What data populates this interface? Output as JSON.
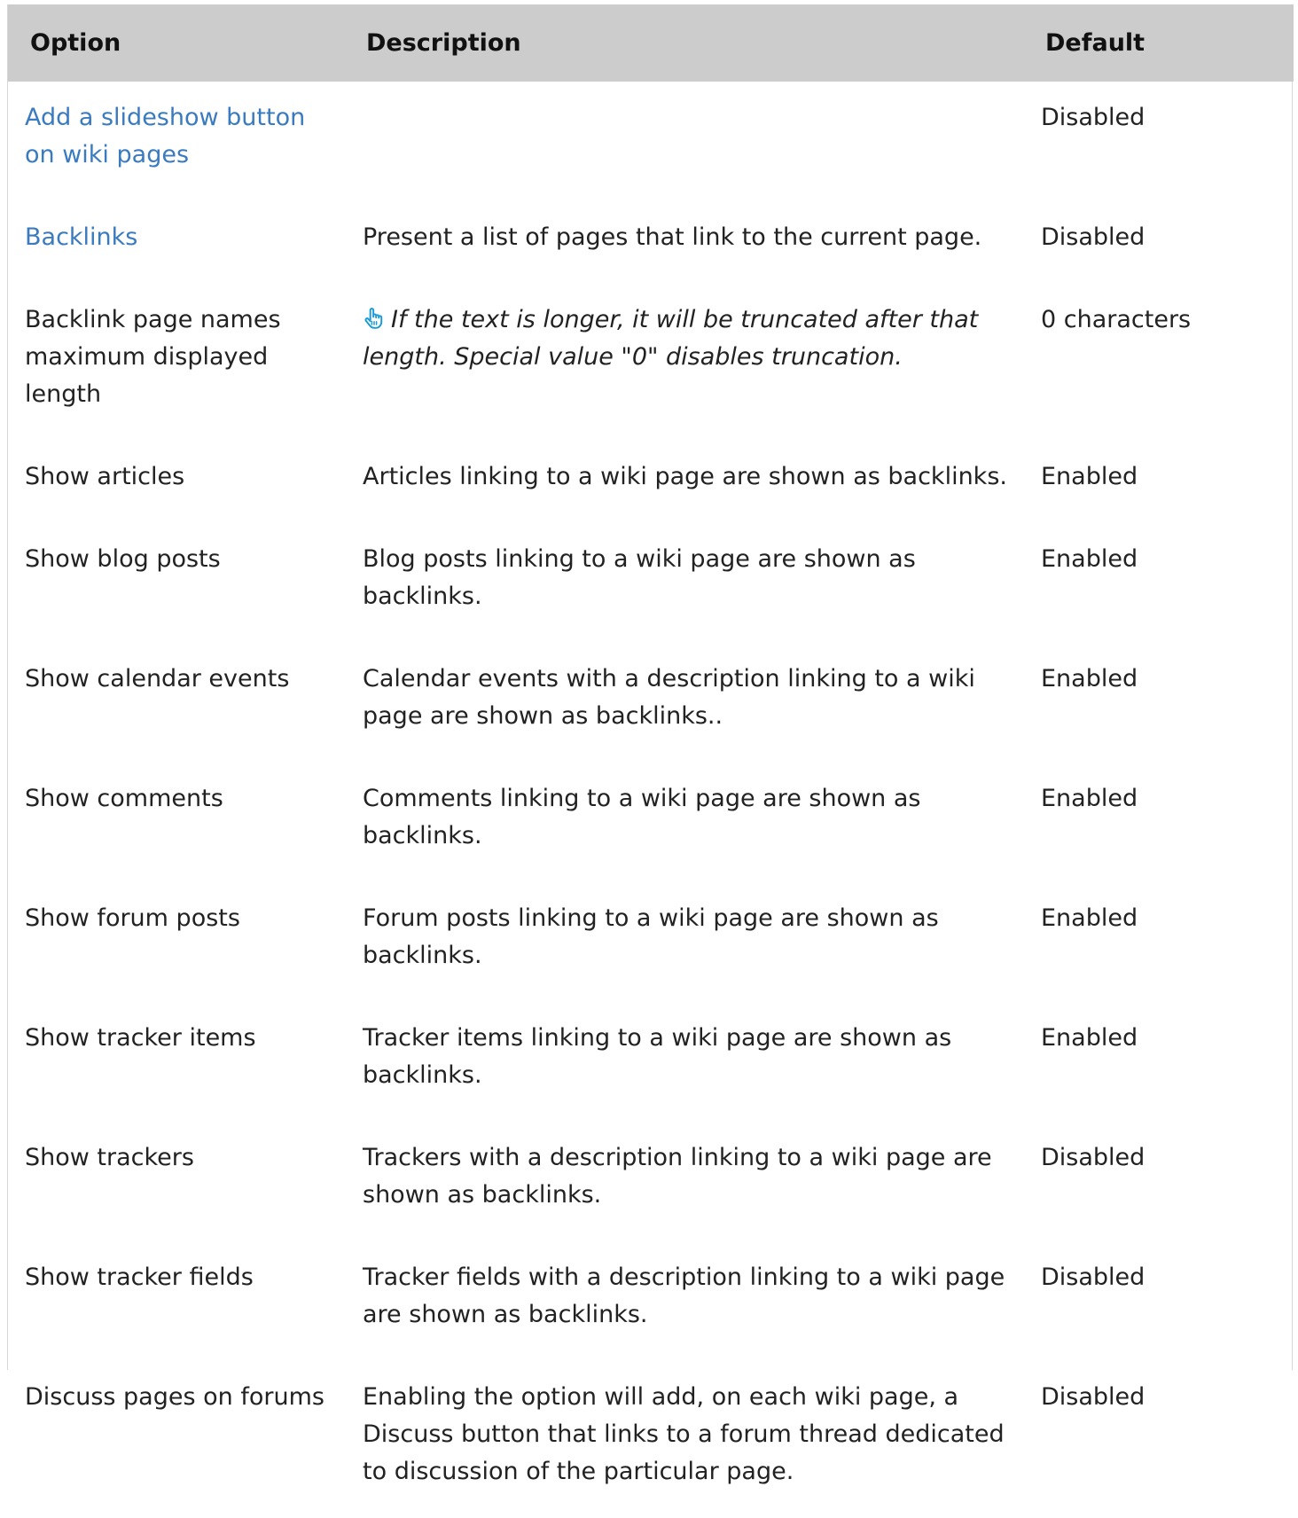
{
  "table": {
    "headers": {
      "option": "Option",
      "description": "Description",
      "default": "Default"
    },
    "rows": [
      {
        "option": "Add a slideshow button on wiki pages",
        "option_is_link": true,
        "description": "",
        "default": "Disabled"
      },
      {
        "option": "Backlinks",
        "option_is_link": true,
        "description": "Present a list of pages that link to the current page.",
        "default": "Disabled"
      },
      {
        "option": "Backlink page names maximum displayed length",
        "option_is_link": false,
        "description": "If the text is longer, it will be truncated after that length. Special value \"0\" disables truncation.",
        "description_icon": "pointing-hand-icon",
        "default": "0 characters"
      },
      {
        "option": "Show articles",
        "option_is_link": false,
        "description": "Articles linking to a wiki page are shown as backlinks.",
        "default": "Enabled"
      },
      {
        "option": "Show blog posts",
        "option_is_link": false,
        "description": "Blog posts linking to a wiki page are shown as backlinks.",
        "default": "Enabled"
      },
      {
        "option": "Show calendar events",
        "option_is_link": false,
        "description": "Calendar events with a description linking to a wiki page are shown as backlinks..",
        "default": "Enabled"
      },
      {
        "option": "Show comments",
        "option_is_link": false,
        "description": "Comments linking to a wiki page are shown as backlinks.",
        "default": "Enabled"
      },
      {
        "option": "Show forum posts",
        "option_is_link": false,
        "description": "Forum posts linking to a wiki page are shown as backlinks.",
        "default": "Enabled"
      },
      {
        "option": "Show tracker items",
        "option_is_link": false,
        "description": "Tracker items linking to a wiki page are shown as backlinks.",
        "default": "Enabled"
      },
      {
        "option": "Show trackers",
        "option_is_link": false,
        "description": "Trackers with a description linking to a wiki page are shown as backlinks.",
        "default": "Disabled"
      },
      {
        "option": "Show tracker fields",
        "option_is_link": false,
        "description": "Tracker fields with a description linking to a wiki page are shown as backlinks.",
        "default": "Disabled"
      },
      {
        "option": "Discuss pages on forums",
        "option_is_link": false,
        "description": "Enabling the option will add, on each wiki page, a Discuss button that links to a forum thread dedicated to discussion of the particular page.",
        "default": "Disabled"
      }
    ]
  },
  "colors": {
    "header_bg": "#cccccc",
    "link": "#3a7bbf",
    "icon": "#1a9bd7",
    "text": "#222222"
  }
}
